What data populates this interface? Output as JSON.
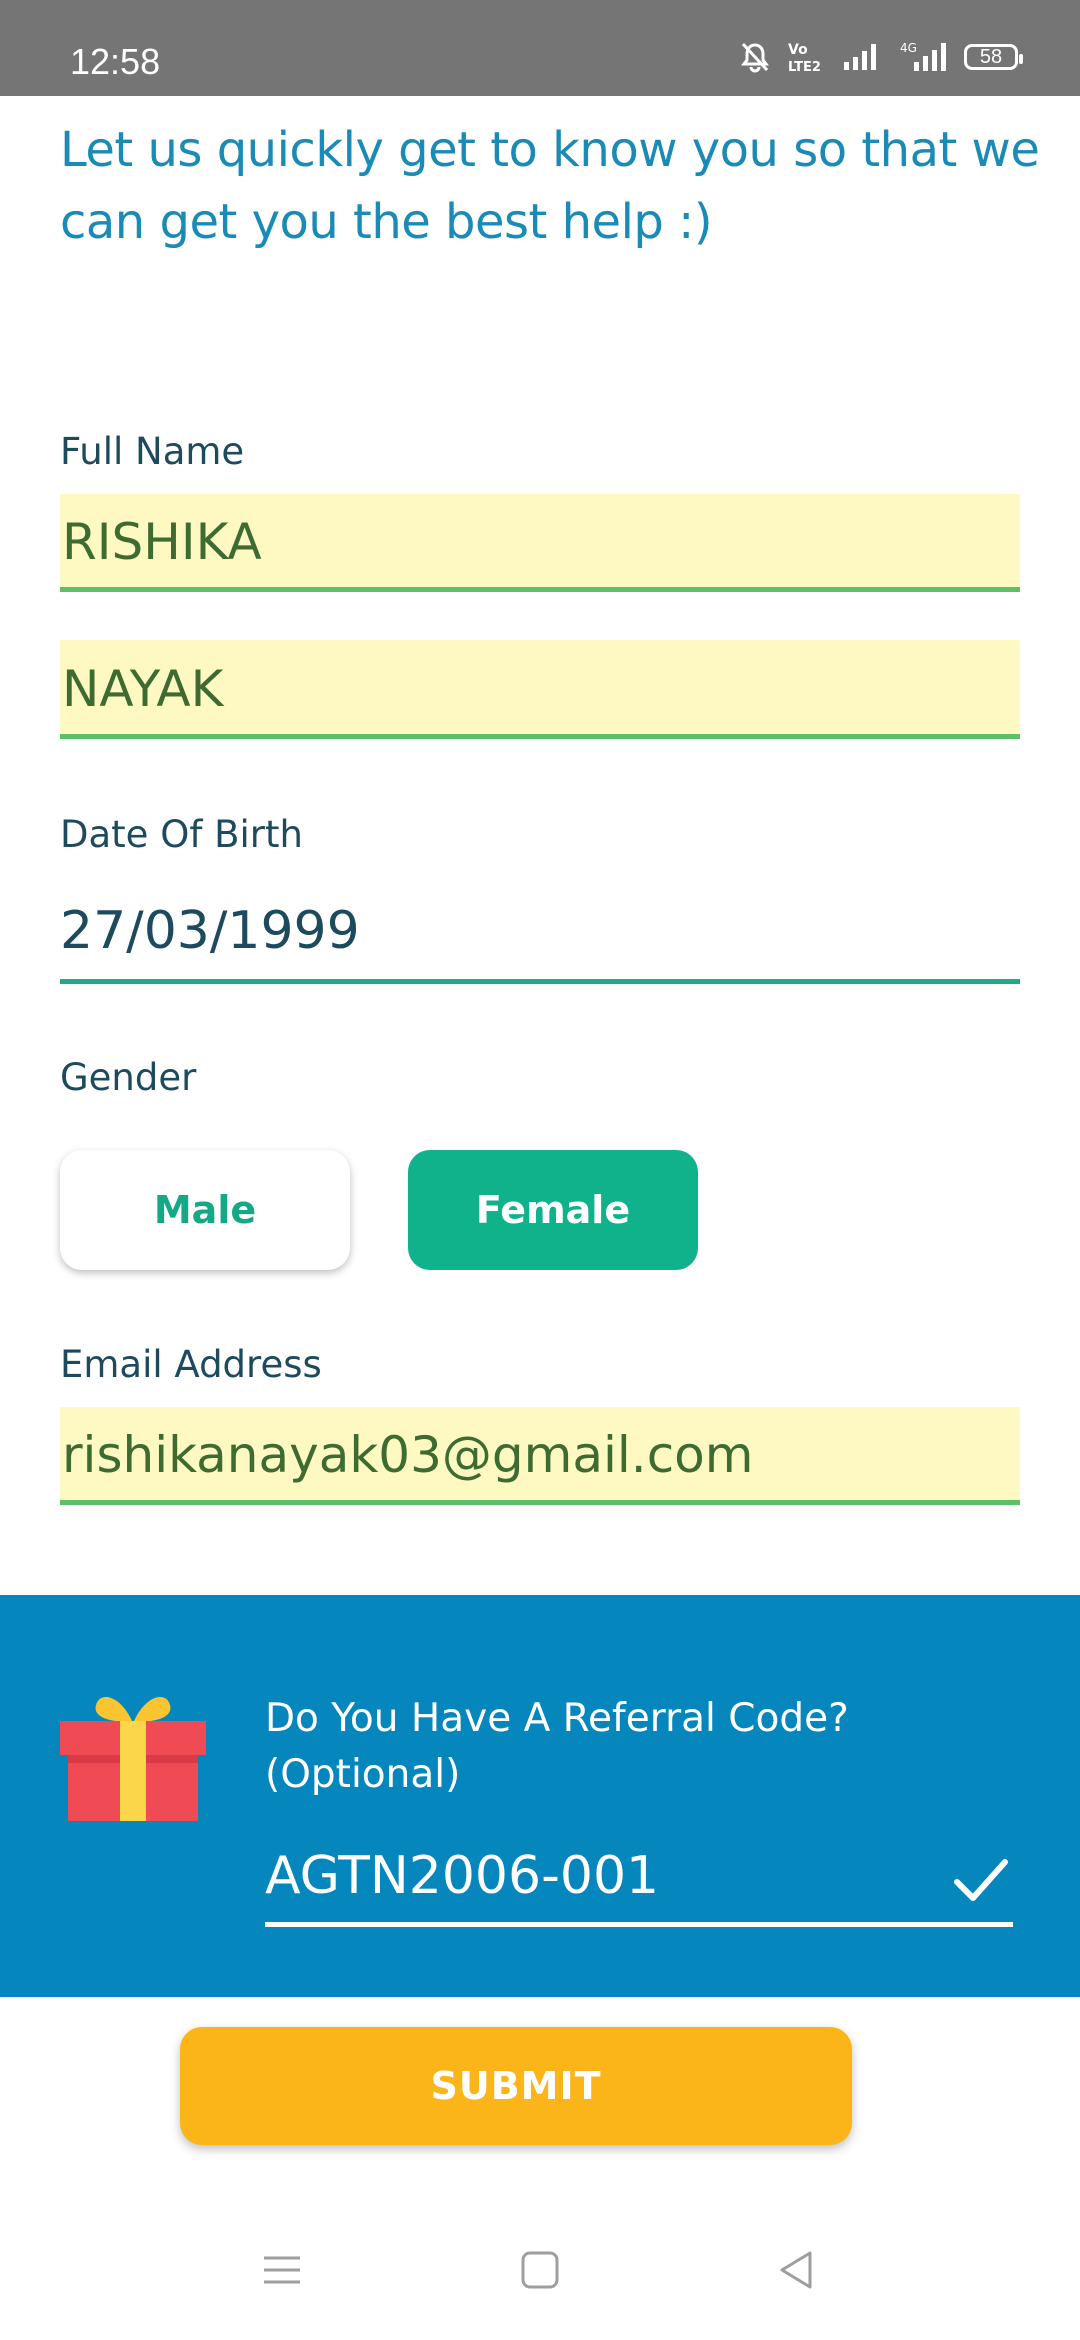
{
  "status_bar": {
    "time": "12:58",
    "battery": "58",
    "network": "4G",
    "volte": "Vo LTE2"
  },
  "intro_text": "Let us quickly get to know you so that we can get you the best help :)",
  "full_name": {
    "label": "Full Name",
    "first_name": "RISHIKA",
    "last_name": "NAYAK"
  },
  "dob": {
    "label": "Date Of Birth",
    "value": "27/03/1999"
  },
  "gender": {
    "label": "Gender",
    "options": [
      "Male",
      "Female"
    ],
    "selected": "Female"
  },
  "email": {
    "label": "Email Address",
    "value": "rishikanayak03@gmail.com"
  },
  "referral": {
    "title": "Do You Have A Referral Code? (Optional)",
    "code": "AGTN2006-001"
  },
  "submit_label": "SUBMIT",
  "colors": {
    "accent_blue": "#0587bd",
    "green": "#10b28b",
    "submit_yellow": "#fbb518",
    "field_bg": "#fef9c3"
  }
}
